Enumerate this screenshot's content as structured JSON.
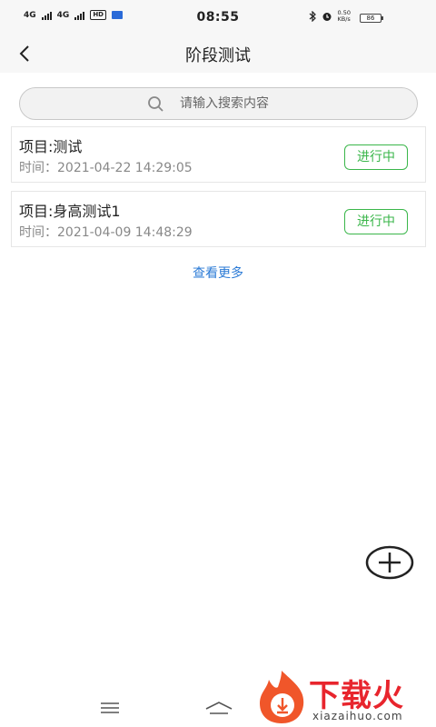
{
  "status_bar": {
    "network_1": "4G",
    "network_2": "4G",
    "hd_label": "HD",
    "time": "08:55",
    "speed_value": "0.50",
    "speed_unit": "KB/s",
    "battery": "86"
  },
  "appbar": {
    "back_icon": "chevron-left-icon",
    "title": "阶段测试"
  },
  "search": {
    "icon": "search-icon",
    "placeholder": "请输入搜索内容"
  },
  "items": [
    {
      "title": "项目:测试",
      "time_label": "时间：",
      "time": "2021-04-22 14:29:05",
      "status": "进行中"
    },
    {
      "title": "项目:身高测试1",
      "time_label": "时间：",
      "time": "2021-04-09 14:48:29",
      "status": "进行中"
    }
  ],
  "more_label": "查看更多",
  "fab_icon": "plus-circle-icon",
  "nav": {
    "menu_icon": "menu-icon",
    "home_icon": "home-icon"
  },
  "watermark": {
    "logo_icon": "flame-download-icon",
    "text": "下载火",
    "sub": "xiazaihuo.com"
  },
  "colors": {
    "accent_green": "#3ab64a",
    "link_blue": "#2a7ad6",
    "watermark_red": "#e8252d"
  }
}
